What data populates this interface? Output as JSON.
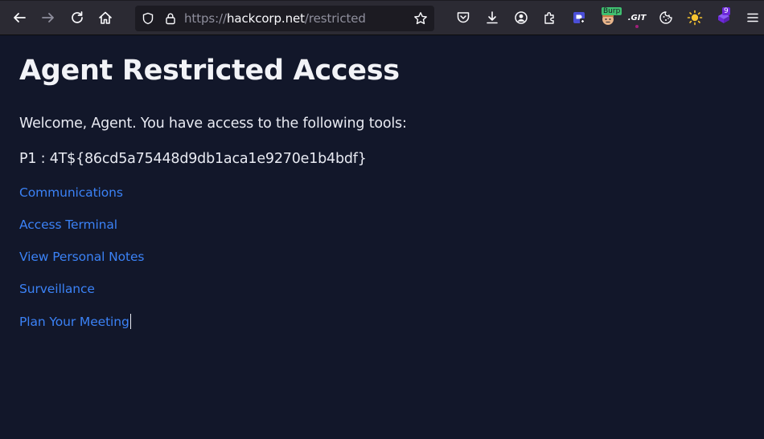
{
  "browser": {
    "url_scheme": "https://",
    "url_host": "hackcorp.net",
    "url_path": "/restricted",
    "extensions": {
      "burp_badge": "Burp",
      "git_label": ".GIT",
      "notification_count": "9"
    }
  },
  "page": {
    "title": "Agent Restricted Access",
    "welcome": "Welcome, Agent. You have access to the following tools:",
    "flag": "P1 : 4T${86cd5a75448d9db1aca1e9270e1b4bdf}",
    "links": [
      {
        "label": "Communications"
      },
      {
        "label": "Access Terminal"
      },
      {
        "label": "View Personal Notes"
      },
      {
        "label": "Surveillance"
      },
      {
        "label": "Plan Your Meeting"
      }
    ]
  },
  "colors": {
    "page_background": "#12172a",
    "link": "#3b82f6",
    "toolbar": "#2b2a33"
  }
}
